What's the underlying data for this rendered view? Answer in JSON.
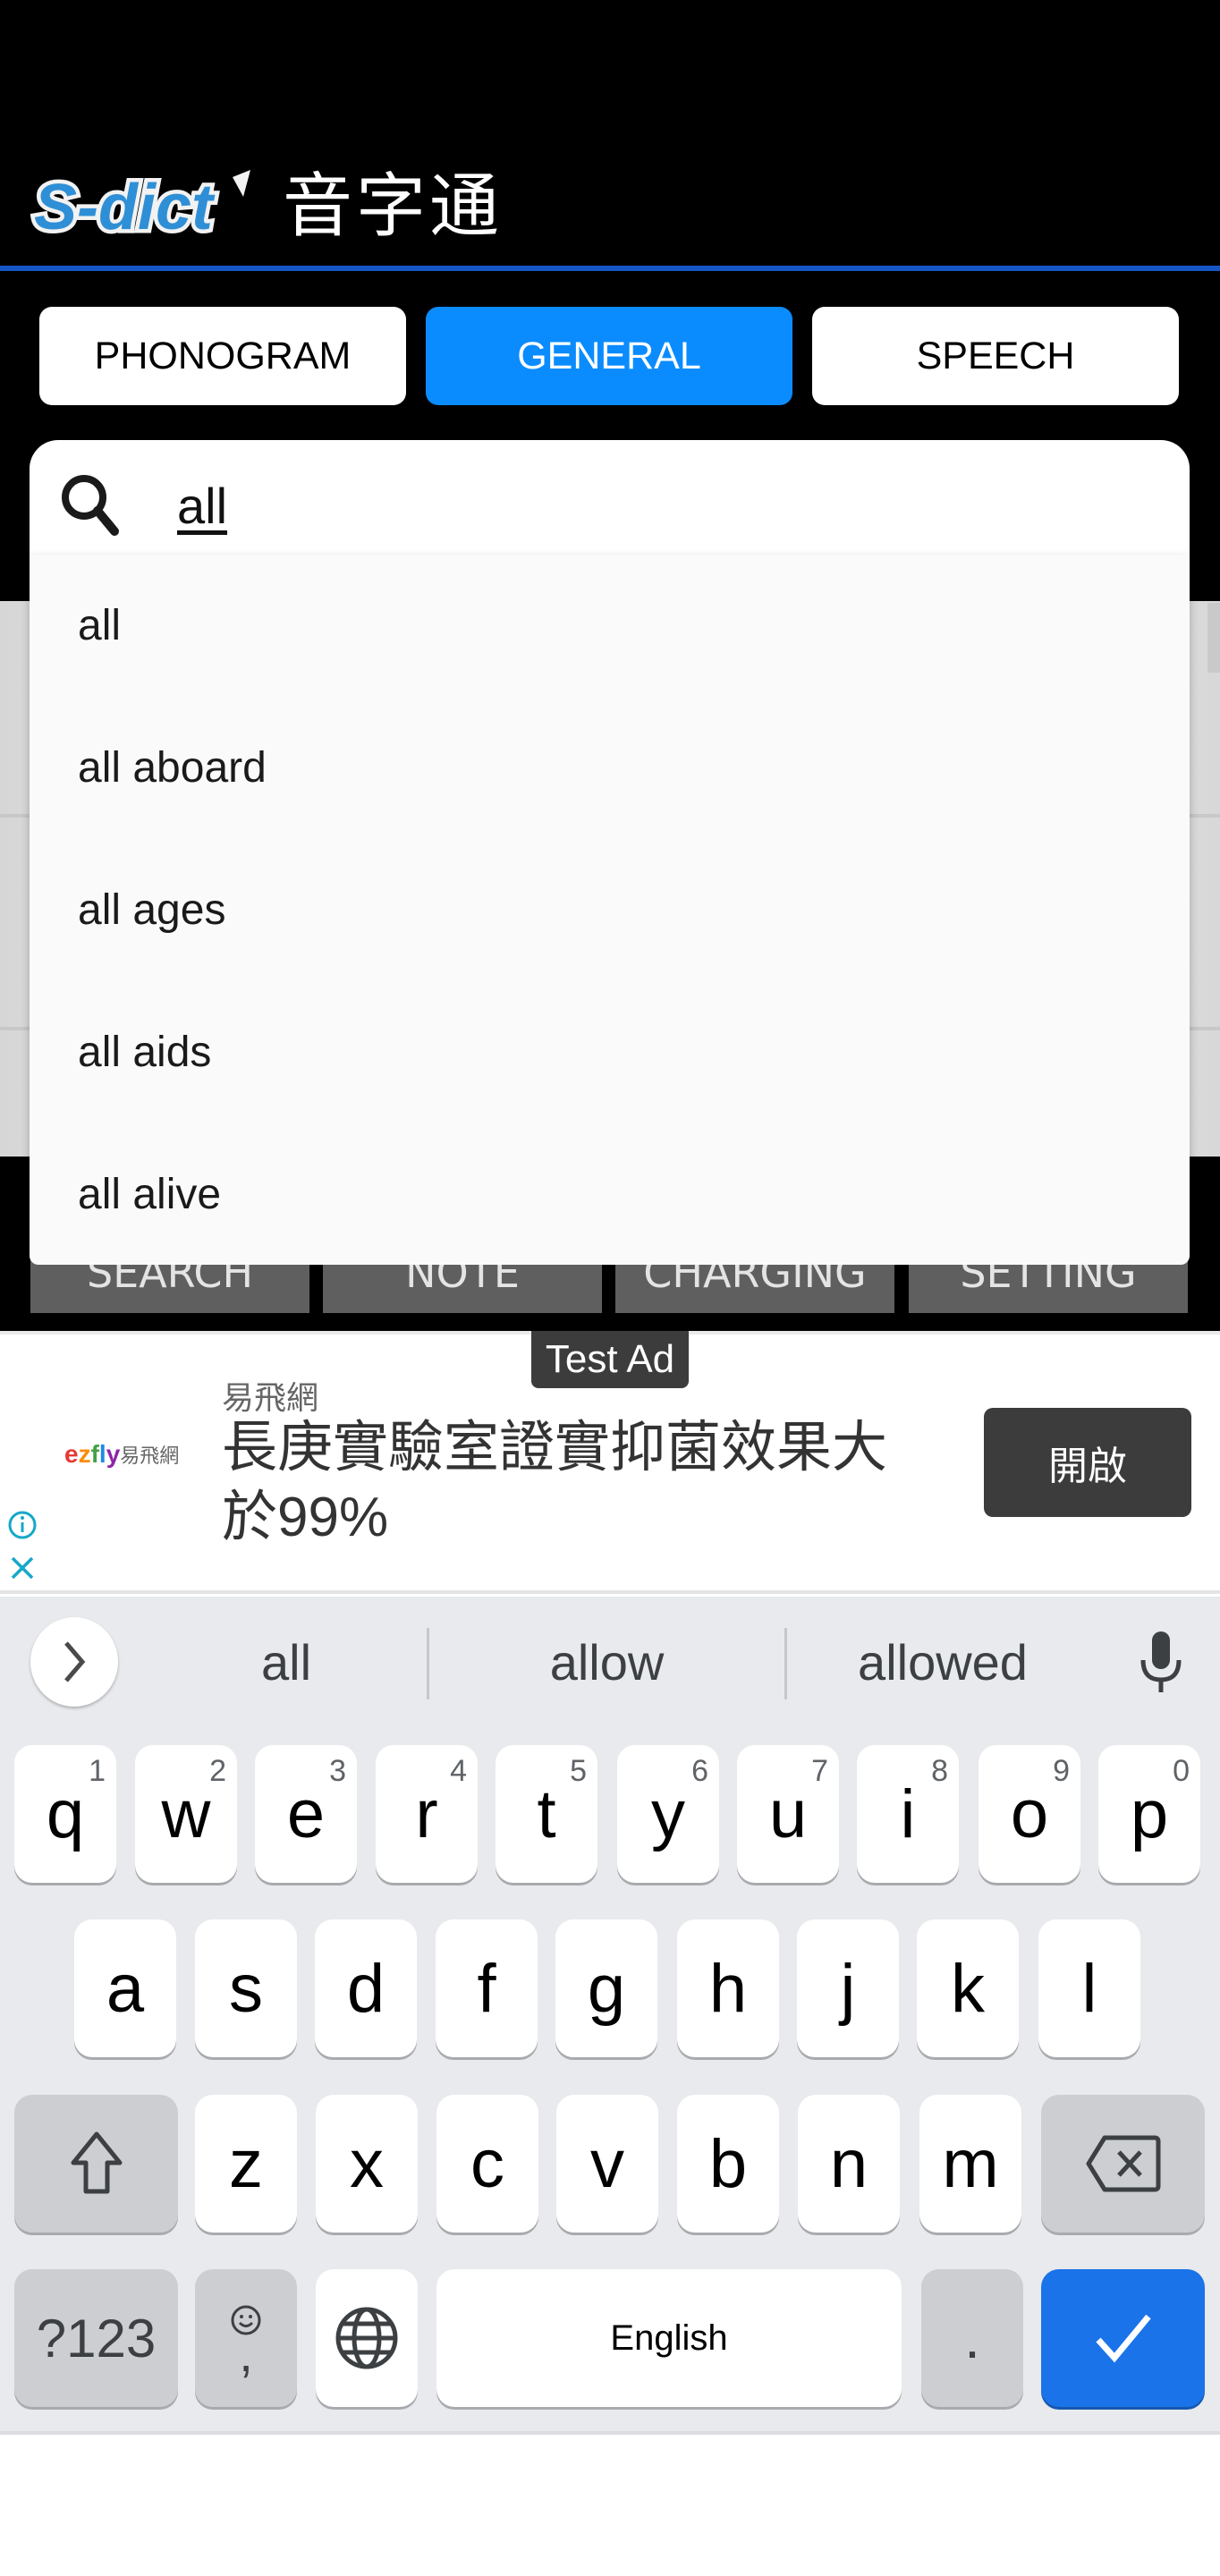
{
  "app": {
    "logo_text": "S-dict",
    "title": "音字通"
  },
  "tabs": [
    {
      "label": "PHONOGRAM",
      "active": false
    },
    {
      "label": "GENERAL",
      "active": true
    },
    {
      "label": "SPEECH",
      "active": false
    }
  ],
  "search": {
    "value": "all",
    "icon": "search-icon"
  },
  "autocomplete": [
    "all",
    "all aboard",
    "all ages",
    "all aids",
    "all alive"
  ],
  "bottom_nav": [
    "SEARCH",
    "NOTE",
    "CHARGING",
    "SETTING"
  ],
  "ad": {
    "badge": "Test Ad",
    "logo_brand": "ezfly",
    "logo_cn": "易飛網",
    "advertiser": "易飛網",
    "headline": "長庚實驗室證實抑菌效果大於99%",
    "cta": "開啟",
    "info_icon": "info-icon",
    "close_icon": "close-icon"
  },
  "keyboard": {
    "suggestions": [
      "all",
      "allow",
      "allowed"
    ],
    "row1": [
      {
        "key": "q",
        "hint": "1"
      },
      {
        "key": "w",
        "hint": "2"
      },
      {
        "key": "e",
        "hint": "3"
      },
      {
        "key": "r",
        "hint": "4"
      },
      {
        "key": "t",
        "hint": "5"
      },
      {
        "key": "y",
        "hint": "6"
      },
      {
        "key": "u",
        "hint": "7"
      },
      {
        "key": "i",
        "hint": "8"
      },
      {
        "key": "o",
        "hint": "9"
      },
      {
        "key": "p",
        "hint": "0"
      }
    ],
    "row2": [
      "a",
      "s",
      "d",
      "f",
      "g",
      "h",
      "j",
      "k",
      "l"
    ],
    "row3": [
      "z",
      "x",
      "c",
      "v",
      "b",
      "n",
      "m"
    ],
    "symbols_label": "?123",
    "comma_label": ",",
    "space_label": "English",
    "period_label": ".",
    "colors": {
      "enter": "#1a73e8",
      "background": "#e8eaed"
    }
  },
  "colors": {
    "accent_tab": "#0a8cff",
    "header_line": "#1656c4",
    "nav_button": "#5f5f5f"
  }
}
